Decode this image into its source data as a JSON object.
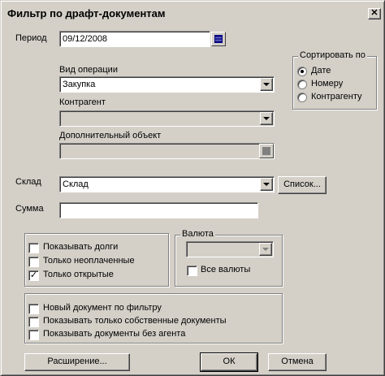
{
  "window": {
    "title": "Фильтр по драфт-документам",
    "close": "✕"
  },
  "period": {
    "label": "Период",
    "value": "09/12/2008"
  },
  "operation": {
    "label": "Вид операции",
    "value": "Закупка"
  },
  "counterparty": {
    "label": "Контрагент",
    "value": ""
  },
  "extra_object": {
    "label": "Дополнительный объект",
    "value": ""
  },
  "sort": {
    "title": "Сортировать по",
    "options": [
      "Дате",
      "Номеру",
      "Контрагенту"
    ],
    "selected": "Дате"
  },
  "warehouse": {
    "label": "Склад",
    "value": "Склад",
    "list_button": "Список..."
  },
  "sum": {
    "label": "Сумма",
    "value": ""
  },
  "options1": [
    {
      "label": "Показывать долги",
      "checked": false
    },
    {
      "label": "Только неоплаченные",
      "checked": false
    },
    {
      "label": "Только открытые",
      "checked": true
    }
  ],
  "currency": {
    "title": "Валюта",
    "value": "",
    "all_label": "Все валюты",
    "all_checked": false
  },
  "options2": [
    {
      "label": "Новый документ по фильтру",
      "checked": false
    },
    {
      "label": "Показывать только собственные документы",
      "checked": false
    },
    {
      "label": "Показывать документы без агента",
      "checked": false
    }
  ],
  "buttons": {
    "extend": "Расширение...",
    "ok": "ОК",
    "cancel": "Отмена"
  }
}
